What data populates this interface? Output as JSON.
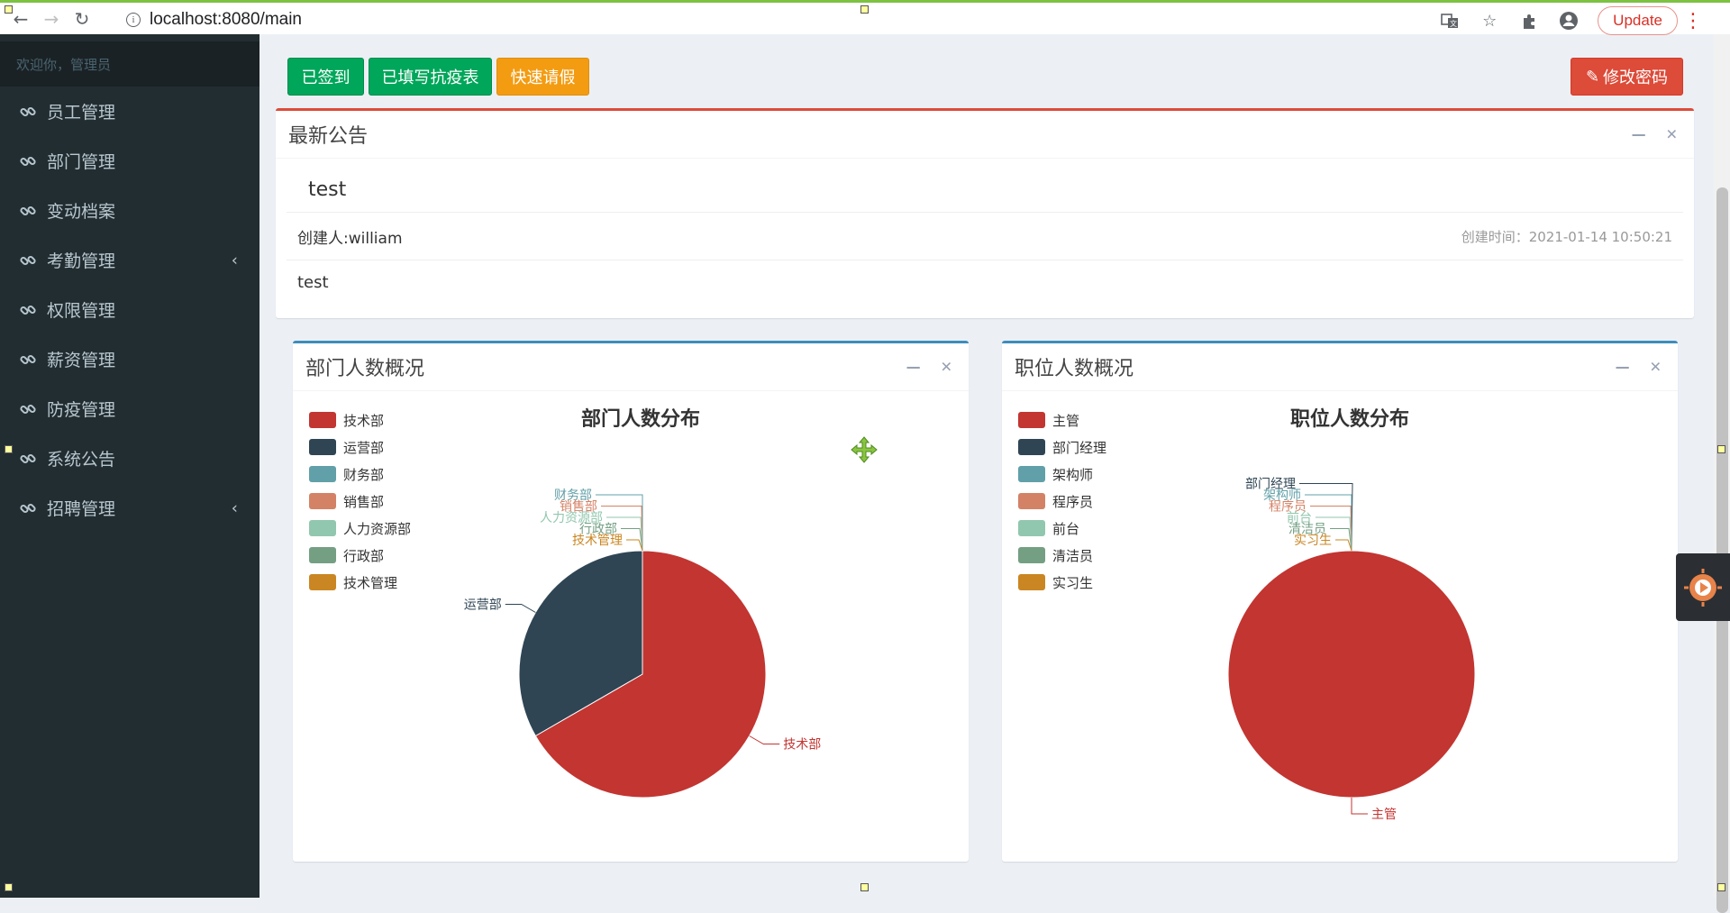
{
  "browser": {
    "url": "localhost:8080/main",
    "update_label": "Update"
  },
  "sidebar": {
    "welcome": "欢迎你，管理员",
    "items": [
      {
        "label": "员工管理",
        "has_submenu": false
      },
      {
        "label": "部门管理",
        "has_submenu": false
      },
      {
        "label": "变动档案",
        "has_submenu": false
      },
      {
        "label": "考勤管理",
        "has_submenu": true
      },
      {
        "label": "权限管理",
        "has_submenu": false
      },
      {
        "label": "薪资管理",
        "has_submenu": false
      },
      {
        "label": "防疫管理",
        "has_submenu": false
      },
      {
        "label": "系统公告",
        "has_submenu": false
      },
      {
        "label": "招聘管理",
        "has_submenu": true
      }
    ]
  },
  "toolbar": {
    "signed_label": "已签到",
    "epidemic_label": "已填写抗疫表",
    "leave_label": "快速请假",
    "change_password_label": "修改密码"
  },
  "notice": {
    "header": "最新公告",
    "title": "test",
    "author": "创建人:william",
    "time": "创建时间：2021-01-14 10:50:21",
    "body": "test"
  },
  "dept_box": {
    "header": "部门人数概况"
  },
  "pos_box": {
    "header": "职位人数概况"
  },
  "colors": [
    "#c23531",
    "#2f4554",
    "#61a0a8",
    "#d48265",
    "#91c7ae",
    "#749f83",
    "#ca8622"
  ],
  "chart_data": [
    {
      "type": "pie",
      "title": "部门人数分布",
      "legend": [
        "技术部",
        "运营部",
        "财务部",
        "销售部",
        "人力资源部",
        "行政部",
        "技术管理"
      ],
      "values": [
        2,
        1,
        0,
        0,
        0,
        0,
        0
      ],
      "legend_position": "top-left"
    },
    {
      "type": "pie",
      "title": "职位人数分布",
      "legend": [
        "主管",
        "部门经理",
        "架构师",
        "程序员",
        "前台",
        "清洁员",
        "实习生"
      ],
      "values": [
        1,
        0,
        0,
        0,
        0,
        0,
        0
      ],
      "legend_position": "top-left"
    }
  ]
}
